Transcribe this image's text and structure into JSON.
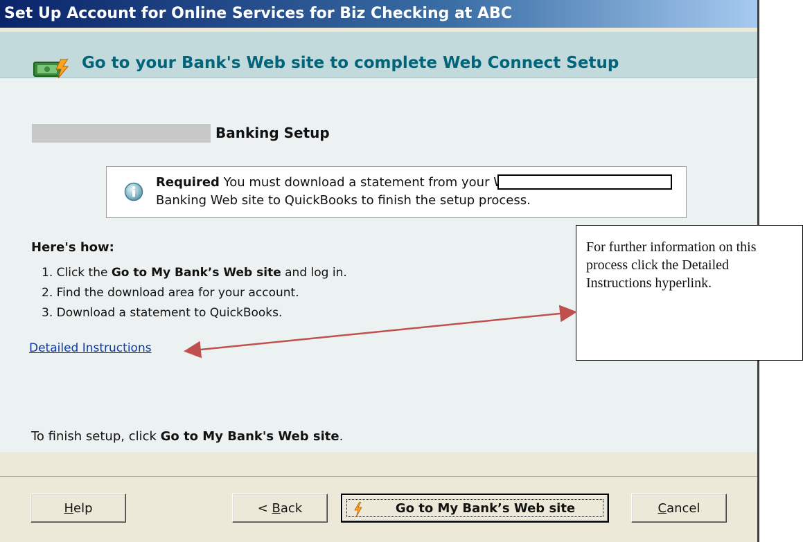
{
  "window": {
    "title": "Set Up Account for Online Services for Biz Checking at ABC"
  },
  "header": {
    "icon": "money-lightning-icon",
    "title": "Go to your Bank's Web site to complete Web Connect Setup"
  },
  "section": {
    "heading": "Banking Setup"
  },
  "notice": {
    "icon": "info-icon",
    "bold": "Required",
    "line1": " You must download a statement from your W",
    "line2": "Banking Web site to QuickBooks to finish the setup process."
  },
  "howto": {
    "heading": "Here's how:",
    "steps": {
      "s1_pre": "1. Click the ",
      "s1_bold": "Go to My Bank’s Web site",
      "s1_post": " and log in.",
      "s2": "2. Find the download area for your account.",
      "s3": "3. Download a statement to QuickBooks."
    },
    "link": "Detailed Instructions"
  },
  "finish": {
    "pre": "To finish setup, click ",
    "bold": "Go to My Bank's Web site",
    "post": "."
  },
  "buttons": {
    "help": {
      "mnemonic": "H",
      "rest": "elp"
    },
    "back": {
      "pre": "< ",
      "mnemonic": "B",
      "rest": "ack"
    },
    "go": "Go to My Bank’s Web site",
    "cancel": {
      "mnemonic": "C",
      "rest": "ancel"
    }
  },
  "callout": {
    "text": "For further information on this process click the Detailed Instructions hyperlink."
  },
  "colors": {
    "title_bar_start": "#0a246a",
    "header_text": "#00657a",
    "link": "#0b3aa8",
    "arrow": "#c0504d"
  }
}
